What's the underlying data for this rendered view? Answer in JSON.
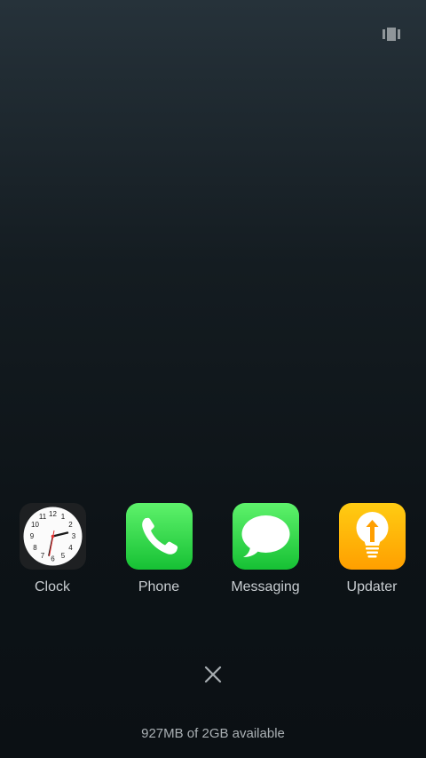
{
  "header": {
    "layout_toggle_icon": "cards-layout-icon"
  },
  "recent_apps": [
    {
      "label": "Clock",
      "icon": "clock-icon",
      "color": "#1e2022"
    },
    {
      "label": "Phone",
      "icon": "phone-icon",
      "color": "#2fd24a"
    },
    {
      "label": "Messaging",
      "icon": "message-bubble-icon",
      "color": "#2fd24a"
    },
    {
      "label": "Updater",
      "icon": "lightbulb-arrow-icon",
      "color": "#ffb400"
    }
  ],
  "clock_face": {
    "numbers": [
      "12",
      "1",
      "2",
      "3",
      "4",
      "5",
      "6",
      "7",
      "8",
      "9",
      "10",
      "11"
    ]
  },
  "footer": {
    "close_all_icon": "close-icon",
    "memory_status": "927MB of 2GB available"
  }
}
